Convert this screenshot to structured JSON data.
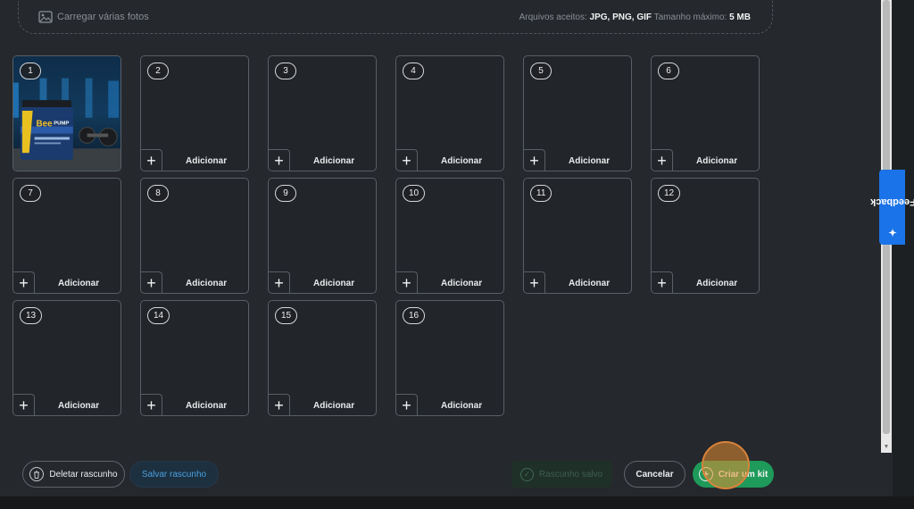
{
  "upload": {
    "label": "Carregar várias fotos",
    "accepted_prefix": "Arquivos aceitos: ",
    "accepted_types": "JPG, PNG, GIF",
    "max_size_prefix": " Tamanho máximo: ",
    "max_size": "5 MB"
  },
  "slots": [
    {
      "number": "1",
      "filled": true
    },
    {
      "number": "2",
      "add_label": "Adicionar"
    },
    {
      "number": "3",
      "add_label": "Adicionar"
    },
    {
      "number": "4",
      "add_label": "Adicionar"
    },
    {
      "number": "5",
      "add_label": "Adicionar"
    },
    {
      "number": "6",
      "add_label": "Adicionar"
    },
    {
      "number": "7",
      "add_label": "Adicionar"
    },
    {
      "number": "8",
      "add_label": "Adicionar"
    },
    {
      "number": "9",
      "add_label": "Adicionar"
    },
    {
      "number": "10",
      "add_label": "Adicionar"
    },
    {
      "number": "11",
      "add_label": "Adicionar"
    },
    {
      "number": "12",
      "add_label": "Adicionar"
    },
    {
      "number": "13",
      "add_label": "Adicionar"
    },
    {
      "number": "14",
      "add_label": "Adicionar"
    },
    {
      "number": "15",
      "add_label": "Adicionar"
    },
    {
      "number": "16",
      "add_label": "Adicionar"
    }
  ],
  "photo": {
    "product_text_1": "Bee",
    "product_text_2": "PUMP"
  },
  "feedback_tab": {
    "label": "Feedback"
  },
  "footer": {
    "delete_label": "Deletar rascunho",
    "save_label": "Salvar rascunho",
    "draft_saved_label": "Rascunho salvo",
    "cancel_label": "Cancelar",
    "create_kit_label": "Criar um kit"
  },
  "colors": {
    "accent_green": "#1e9a5a",
    "accent_blue": "#1a73e8",
    "save_blue": "#4a9fe0"
  }
}
